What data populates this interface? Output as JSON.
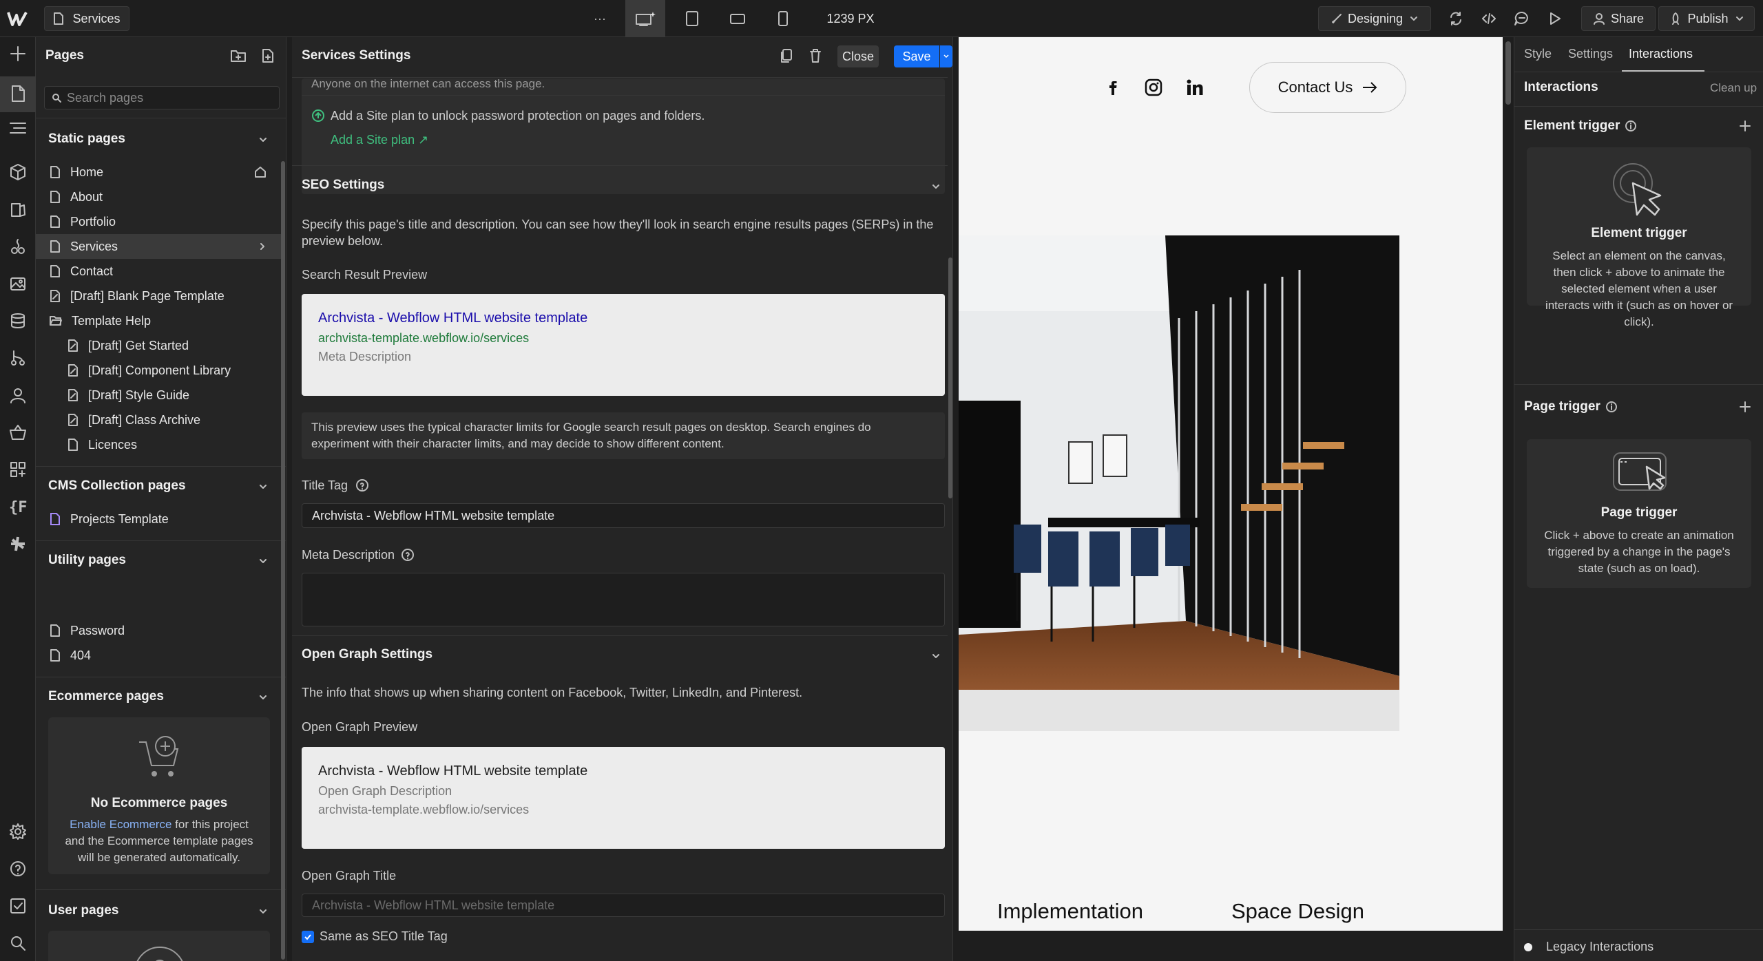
{
  "topbar": {
    "page_name": "Services",
    "width_readout": "1239 PX",
    "mode": "Designing",
    "share": "Share",
    "publish": "Publish",
    "more": "···"
  },
  "pages_panel": {
    "title": "Pages",
    "search_placeholder": "Search pages",
    "static": {
      "title": "Static pages",
      "items": [
        "Home",
        "About",
        "Portfolio",
        "Services",
        "Contact",
        "[Draft] Blank Page Template"
      ],
      "folder": "Template Help",
      "folder_items": [
        "[Draft] Get Started",
        "[Draft] Component Library",
        "[Draft] Style Guide",
        "[Draft] Class Archive",
        "Licences"
      ]
    },
    "cms": {
      "title": "CMS Collection pages",
      "items": [
        "Projects Template"
      ]
    },
    "utility": {
      "title": "Utility pages",
      "items": [
        "Password",
        "404"
      ]
    },
    "ecommerce": {
      "title": "Ecommerce pages",
      "empty_title": "No Ecommerce pages",
      "link": "Enable Ecommerce",
      "text1": " for this project",
      "text2": "and the Ecommerce template pages",
      "text3": "will be generated automatically."
    },
    "user": {
      "title": "User pages"
    }
  },
  "settings": {
    "title": "Services Settings",
    "close": "Close",
    "save": "Save",
    "top_text": "Anyone on the internet can access this page.",
    "siteplan_text": "Add a Site plan to unlock password protection on pages and folders.",
    "siteplan_link": "Add a Site plan ↗",
    "seo": {
      "title": "SEO Settings",
      "desc1": "Specify this page's title and description. You can see how they'll look in search engine results pages (SERPs) in the",
      "desc2": "preview below.",
      "preview_label": "Search Result Preview",
      "preview_title": "Archvista - Webflow HTML website template",
      "preview_url": "archvista-template.webflow.io/services",
      "preview_meta": "Meta Description",
      "note1": "This preview uses the typical character limits for Google search result pages on desktop. Search engines do",
      "note2": "experiment with their character limits, and may decide to show different content.",
      "title_tag_label": "Title Tag",
      "title_tag_value": "Archvista - Webflow HTML website template",
      "meta_label": "Meta Description"
    },
    "og": {
      "title": "Open Graph Settings",
      "desc": "The info that shows up when sharing content on Facebook, Twitter, LinkedIn, and Pinterest.",
      "preview_label": "Open Graph Preview",
      "preview_title": "Archvista - Webflow HTML website template",
      "preview_desc": "Open Graph Description",
      "preview_url": "archvista-template.webflow.io/services",
      "og_title_label": "Open Graph Title",
      "og_title_placeholder": "Archvista - Webflow HTML website template",
      "same_as": "Same as SEO Title Tag"
    }
  },
  "canvas": {
    "contact": "Contact Us",
    "label1": "Implementation",
    "label2": "Space Design"
  },
  "right_panel": {
    "tabs": [
      "Style",
      "Settings",
      "Interactions"
    ],
    "section_title": "Interactions",
    "cleanup": "Clean up",
    "element_trigger": {
      "title": "Element trigger",
      "card_title": "Element trigger",
      "text": [
        "Select an element on the canvas,",
        "then click + above to animate the",
        "selected element when a user",
        "interacts with it (such as on hover or",
        "click)."
      ]
    },
    "page_trigger": {
      "title": "Page trigger",
      "card_title": "Page trigger",
      "text": [
        "Click + above to create an animation",
        "triggered by a change in the page's",
        "state (such as on load)."
      ]
    },
    "legacy": "Legacy Interactions"
  },
  "colors": {
    "accent": "#146ef5",
    "panel": "#252525",
    "link": "#8ab4f8"
  }
}
